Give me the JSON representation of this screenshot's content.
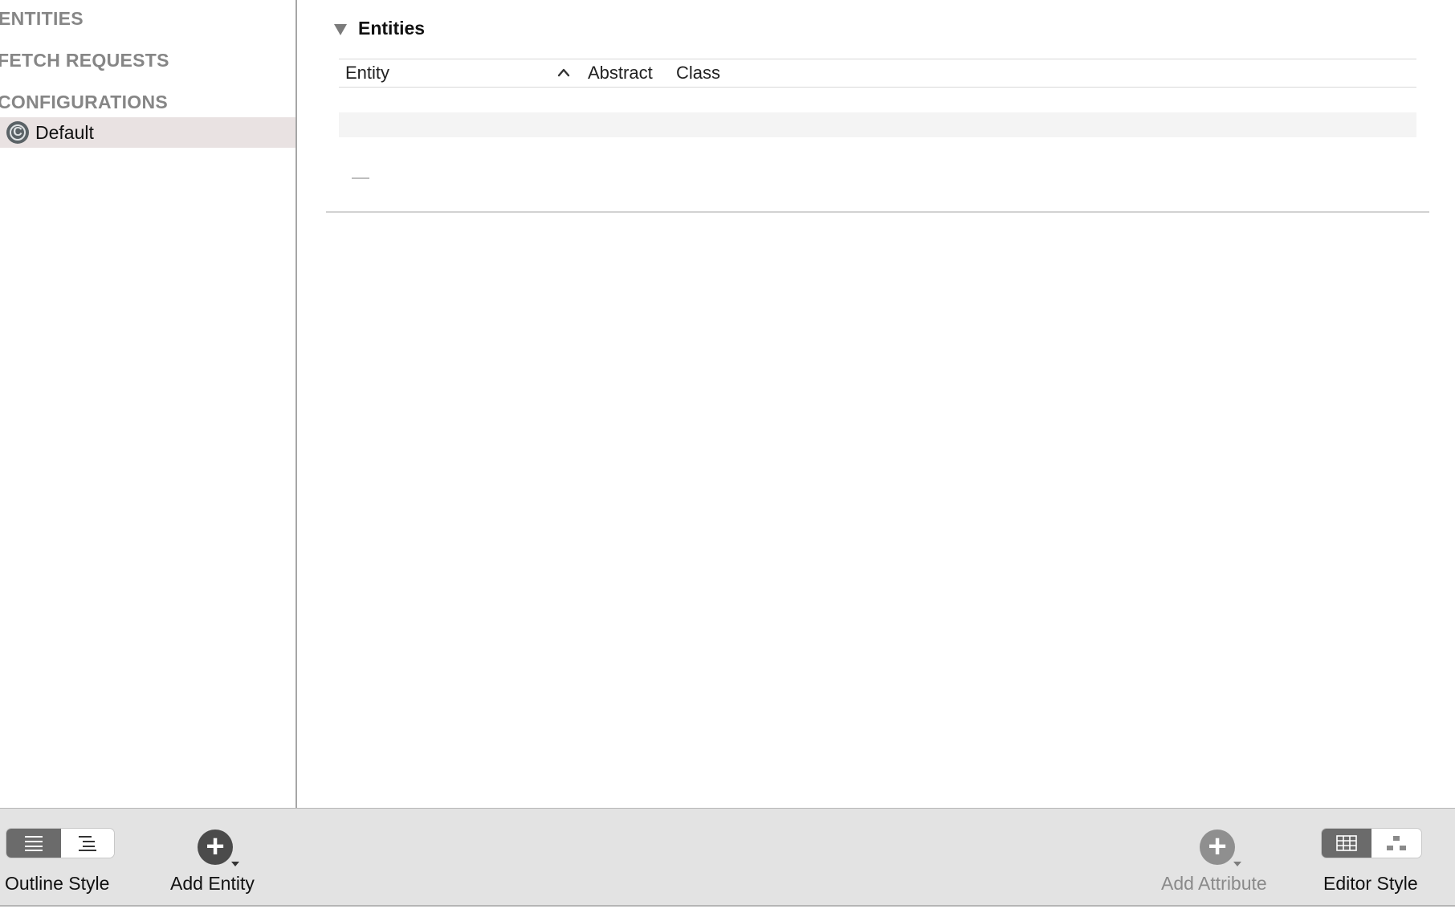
{
  "sidebar": {
    "sections": {
      "entities": "ENTITIES",
      "fetch_requests": "FETCH REQUESTS",
      "configurations": "CONFIGURATIONS"
    },
    "configuration_items": [
      {
        "label": "Default",
        "icon": "configuration-icon",
        "icon_letter": "C",
        "selected": true
      }
    ]
  },
  "editor": {
    "section_title": "Entities",
    "table": {
      "columns": [
        "Entity",
        "Abstract",
        "Class"
      ],
      "sort_column": "Entity",
      "sort_direction": "ascending",
      "rows": []
    },
    "remove_button_label": "—"
  },
  "toolbar": {
    "outline_style_label": "Outline Style",
    "add_entity_label": "Add Entity",
    "add_attribute_label": "Add Attribute",
    "editor_style_label": "Editor Style",
    "add_symbol": "+"
  },
  "colors": {
    "selection": "#e9e2e2",
    "toolbar_bg": "#e3e3e3",
    "section_text": "#868686",
    "disabled_text": "#8a8a8a"
  }
}
